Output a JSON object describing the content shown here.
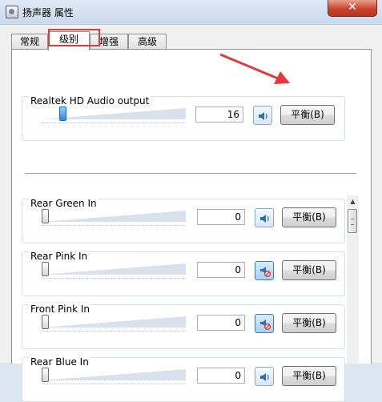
{
  "window": {
    "title": "扬声器 属性",
    "close_label": "✕"
  },
  "tabs": [
    {
      "label": "常规",
      "active": false
    },
    {
      "label": "级别",
      "active": true
    },
    {
      "label": "增强",
      "active": false
    },
    {
      "label": "高级",
      "active": false
    }
  ],
  "channels": [
    {
      "name": "Realtek HD Audio output",
      "value": "16",
      "level_percent": 16,
      "muted": false,
      "balance_label": "平衡(B)"
    },
    {
      "name": "Rear Green In",
      "value": "0",
      "level_percent": 0,
      "muted": false,
      "balance_label": "平衡(B)"
    },
    {
      "name": "Rear Pink In",
      "value": "0",
      "level_percent": 0,
      "muted": true,
      "balance_label": "平衡(B)"
    },
    {
      "name": "Front Pink In",
      "value": "0",
      "level_percent": 0,
      "muted": true,
      "balance_label": "平衡(B)"
    },
    {
      "name": "Rear Blue In",
      "value": "0",
      "level_percent": 0,
      "muted": false,
      "balance_label": "平衡(B)"
    }
  ],
  "colors": {
    "annotation_red": "#e03a3a",
    "accent_blue": "#2a8ad8"
  }
}
